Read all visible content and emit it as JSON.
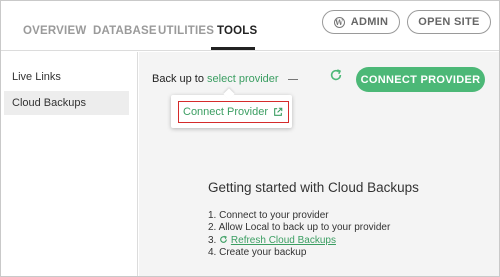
{
  "tabs": [
    {
      "label": "OVERVIEW"
    },
    {
      "label": "DATABASE"
    },
    {
      "label": "UTILITIES"
    },
    {
      "label": "TOOLS",
      "active": true
    }
  ],
  "header_buttons": {
    "admin_label": "ADMIN",
    "admin_icon": "wordpress-icon",
    "open_site_label": "OPEN SITE"
  },
  "sidebar": {
    "items": [
      {
        "label": "Live Links"
      },
      {
        "label": "Cloud Backups",
        "active": true
      }
    ]
  },
  "backup": {
    "prefix": "Back up to",
    "provider_link": "select provider",
    "refresh_icon": "refresh-icon",
    "connect_button": "CONNECT PROVIDER"
  },
  "dropdown": {
    "item_label": "Connect Provider",
    "item_icon": "external-link-icon"
  },
  "getting_started": {
    "title": "Getting started with Cloud Backups",
    "steps": [
      "1. Connect to your provider",
      "2. Allow Local to back up to your provider",
      "3.",
      "4. Create your backup"
    ],
    "refresh_link": "Refresh Cloud Backups"
  },
  "colors": {
    "accent_green": "#4cb877",
    "link_green": "#3b9e62",
    "highlight_red": "#d52b2b"
  }
}
